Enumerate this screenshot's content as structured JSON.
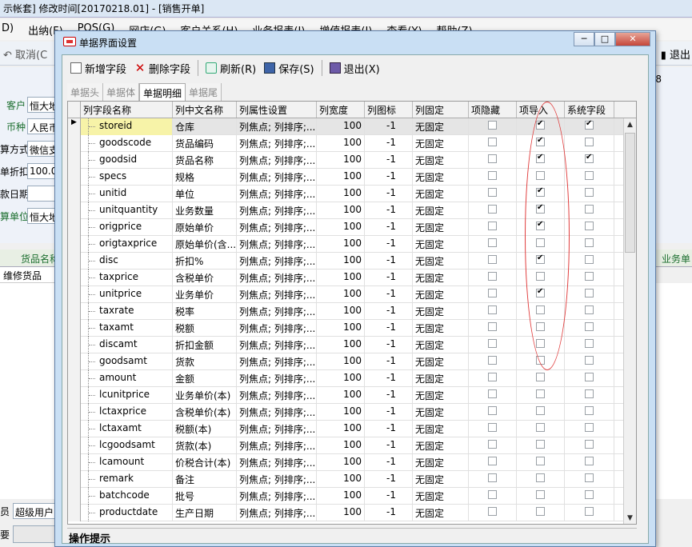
{
  "bg": {
    "title": "示帐套] 修改时间[20170218.01] - [销售开单]",
    "menu": [
      "D)",
      "出纳(F)",
      "POS(G)",
      "网店(G)",
      "客户关系(H)",
      "业务报表(I)",
      "增值报表(J)",
      "查看(Y)",
      "帮助(Z)"
    ],
    "cancel": "取消(C",
    "exit": "退出",
    "num8": "8",
    "form": [
      {
        "label": "客户",
        "value": "恒大地"
      },
      {
        "label": "币种",
        "value": "人民币"
      },
      {
        "label": "算方式",
        "value": "微信支"
      },
      {
        "label": "单折扣",
        "value": "100.0"
      },
      {
        "label": "款日期",
        "value": ""
      },
      {
        "label": "算单位",
        "value": "恒大地"
      }
    ],
    "grid_left": "货品名称",
    "grid_right": "业务单",
    "row1": "维修货品",
    "user_label": "员",
    "user_value": "超级用户",
    "memo_label": "要"
  },
  "dialog": {
    "title": "单据界面设置",
    "toolbar": {
      "add": "新增字段",
      "del": "删除字段",
      "refresh": "刷新(R)",
      "save": "保存(S)",
      "exit": "退出(X)"
    },
    "tabs": [
      "单据头",
      "单据体",
      "单据明细",
      "单据尾"
    ],
    "active_tab": 2,
    "columns": [
      "列字段名称",
      "列中文名称",
      "列属性设置",
      "列宽度",
      "列图标",
      "列固定",
      "项隐藏",
      "项导入",
      "系统字段"
    ],
    "rows": [
      {
        "f": "storeid",
        "c": "仓库",
        "attr": "列焦点; 列排序;...",
        "w": "100",
        "icon": "-1",
        "fix": "无固定",
        "hide": false,
        "imp": true,
        "sys": true
      },
      {
        "f": "goodscode",
        "c": "货品编码",
        "attr": "列焦点; 列排序;...",
        "w": "100",
        "icon": "-1",
        "fix": "无固定",
        "hide": false,
        "imp": true,
        "sys": false
      },
      {
        "f": "goodsid",
        "c": "货品名称",
        "attr": "列焦点; 列排序;...",
        "w": "100",
        "icon": "-1",
        "fix": "无固定",
        "hide": false,
        "imp": true,
        "sys": true
      },
      {
        "f": "specs",
        "c": "规格",
        "attr": "列焦点; 列排序;...",
        "w": "100",
        "icon": "-1",
        "fix": "无固定",
        "hide": false,
        "imp": false,
        "sys": false
      },
      {
        "f": "unitid",
        "c": "单位",
        "attr": "列焦点; 列排序;...",
        "w": "100",
        "icon": "-1",
        "fix": "无固定",
        "hide": false,
        "imp": true,
        "sys": false
      },
      {
        "f": "unitquantity",
        "c": "业务数量",
        "attr": "列焦点; 列排序;...",
        "w": "100",
        "icon": "-1",
        "fix": "无固定",
        "hide": false,
        "imp": true,
        "sys": false
      },
      {
        "f": "origprice",
        "c": "原始单价",
        "attr": "列焦点; 列排序;...",
        "w": "100",
        "icon": "-1",
        "fix": "无固定",
        "hide": false,
        "imp": true,
        "sys": false
      },
      {
        "f": "origtaxprice",
        "c": "原始单价(含...",
        "attr": "列焦点; 列排序;...",
        "w": "100",
        "icon": "-1",
        "fix": "无固定",
        "hide": false,
        "imp": false,
        "sys": false
      },
      {
        "f": "disc",
        "c": "折扣%",
        "attr": "列焦点; 列排序;...",
        "w": "100",
        "icon": "-1",
        "fix": "无固定",
        "hide": false,
        "imp": true,
        "sys": false
      },
      {
        "f": "taxprice",
        "c": "含税单价",
        "attr": "列焦点; 列排序;...",
        "w": "100",
        "icon": "-1",
        "fix": "无固定",
        "hide": false,
        "imp": false,
        "sys": false
      },
      {
        "f": "unitprice",
        "c": "业务单价",
        "attr": "列焦点; 列排序;...",
        "w": "100",
        "icon": "-1",
        "fix": "无固定",
        "hide": false,
        "imp": true,
        "sys": false
      },
      {
        "f": "taxrate",
        "c": "税率",
        "attr": "列焦点; 列排序;...",
        "w": "100",
        "icon": "-1",
        "fix": "无固定",
        "hide": false,
        "imp": false,
        "sys": false
      },
      {
        "f": "taxamt",
        "c": "税额",
        "attr": "列焦点; 列排序;...",
        "w": "100",
        "icon": "-1",
        "fix": "无固定",
        "hide": false,
        "imp": false,
        "sys": false
      },
      {
        "f": "discamt",
        "c": "折扣金额",
        "attr": "列焦点; 列排序;...",
        "w": "100",
        "icon": "-1",
        "fix": "无固定",
        "hide": false,
        "imp": false,
        "sys": false
      },
      {
        "f": "goodsamt",
        "c": "货款",
        "attr": "列焦点; 列排序;...",
        "w": "100",
        "icon": "-1",
        "fix": "无固定",
        "hide": false,
        "imp": false,
        "sys": false
      },
      {
        "f": "amount",
        "c": "金额",
        "attr": "列焦点; 列排序;...",
        "w": "100",
        "icon": "-1",
        "fix": "无固定",
        "hide": false,
        "imp": false,
        "sys": false
      },
      {
        "f": "lcunitprice",
        "c": "业务单价(本)",
        "attr": "列焦点; 列排序;...",
        "w": "100",
        "icon": "-1",
        "fix": "无固定",
        "hide": false,
        "imp": false,
        "sys": false
      },
      {
        "f": "lctaxprice",
        "c": "含税单价(本)",
        "attr": "列焦点; 列排序;...",
        "w": "100",
        "icon": "-1",
        "fix": "无固定",
        "hide": false,
        "imp": false,
        "sys": false
      },
      {
        "f": "lctaxamt",
        "c": "税额(本)",
        "attr": "列焦点; 列排序;...",
        "w": "100",
        "icon": "-1",
        "fix": "无固定",
        "hide": false,
        "imp": false,
        "sys": false
      },
      {
        "f": "lcgoodsamt",
        "c": "货款(本)",
        "attr": "列焦点; 列排序;...",
        "w": "100",
        "icon": "-1",
        "fix": "无固定",
        "hide": false,
        "imp": false,
        "sys": false
      },
      {
        "f": "lcamount",
        "c": "价税合计(本)",
        "attr": "列焦点; 列排序;...",
        "w": "100",
        "icon": "-1",
        "fix": "无固定",
        "hide": false,
        "imp": false,
        "sys": false
      },
      {
        "f": "remark",
        "c": "备注",
        "attr": "列焦点; 列排序;...",
        "w": "100",
        "icon": "-1",
        "fix": "无固定",
        "hide": false,
        "imp": false,
        "sys": false
      },
      {
        "f": "batchcode",
        "c": "批号",
        "attr": "列焦点; 列排序;...",
        "w": "100",
        "icon": "-1",
        "fix": "无固定",
        "hide": false,
        "imp": false,
        "sys": false
      },
      {
        "f": "productdate",
        "c": "生产日期",
        "attr": "列焦点; 列排序;...",
        "w": "100",
        "icon": "-1",
        "fix": "无固定",
        "hide": false,
        "imp": false,
        "sys": false
      }
    ],
    "status": "操作提示"
  }
}
